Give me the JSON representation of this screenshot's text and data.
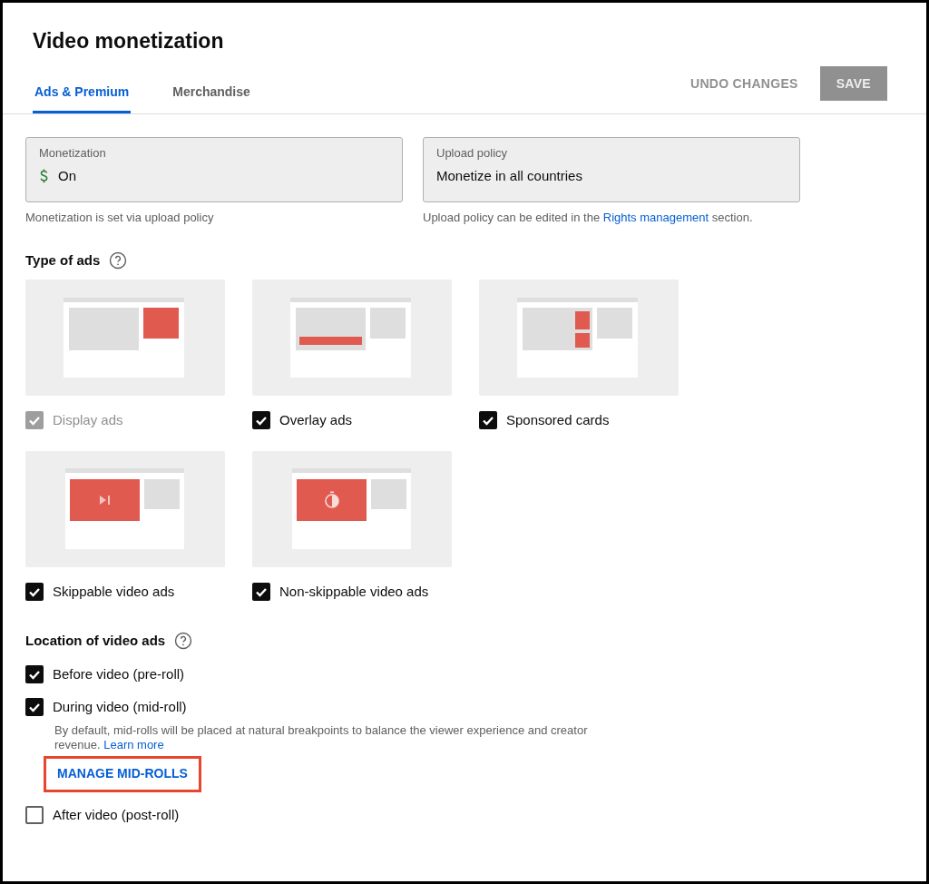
{
  "title": "Video monetization",
  "tabs": [
    {
      "label": "Ads & Premium",
      "selected": true
    },
    {
      "label": "Merchandise",
      "selected": false
    }
  ],
  "actions": {
    "undo": "UNDO CHANGES",
    "save": "SAVE",
    "save_disabled": true
  },
  "fields": [
    {
      "label": "Monetization",
      "value": "On",
      "kind": "money",
      "note_before": "Monetization is set via upload policy"
    },
    {
      "label": "Upload policy",
      "value": "Monetize in all countries",
      "kind": "plain",
      "note_before": "Upload policy can be edited in the ",
      "note_link": "Rights management",
      "note_after": " section."
    }
  ],
  "ad_types": {
    "heading": "Type of ads",
    "items": [
      {
        "label": "Display ads",
        "kind": "display",
        "checked": true,
        "disabled": true
      },
      {
        "label": "Overlay ads",
        "kind": "overlay",
        "checked": true,
        "disabled": false
      },
      {
        "label": "Sponsored cards",
        "kind": "sponsored",
        "checked": true,
        "disabled": false
      },
      {
        "label": "Skippable video ads",
        "kind": "skippable",
        "checked": true,
        "disabled": false
      },
      {
        "label": "Non-skippable video ads",
        "kind": "nonskippable",
        "checked": true,
        "disabled": false
      }
    ]
  },
  "locations": {
    "heading": "Location of video ads",
    "items": [
      {
        "label": "Before video (pre-roll)",
        "checked": true
      },
      {
        "label": "During video (mid-roll)",
        "checked": true,
        "description": "By default, mid-rolls will be placed at natural breakpoints to balance the viewer experience and creator revenue.",
        "link": "Learn more",
        "button": "MANAGE MID-ROLLS",
        "highlighted": true
      },
      {
        "label": "After video (post-roll)",
        "checked": false
      }
    ]
  }
}
